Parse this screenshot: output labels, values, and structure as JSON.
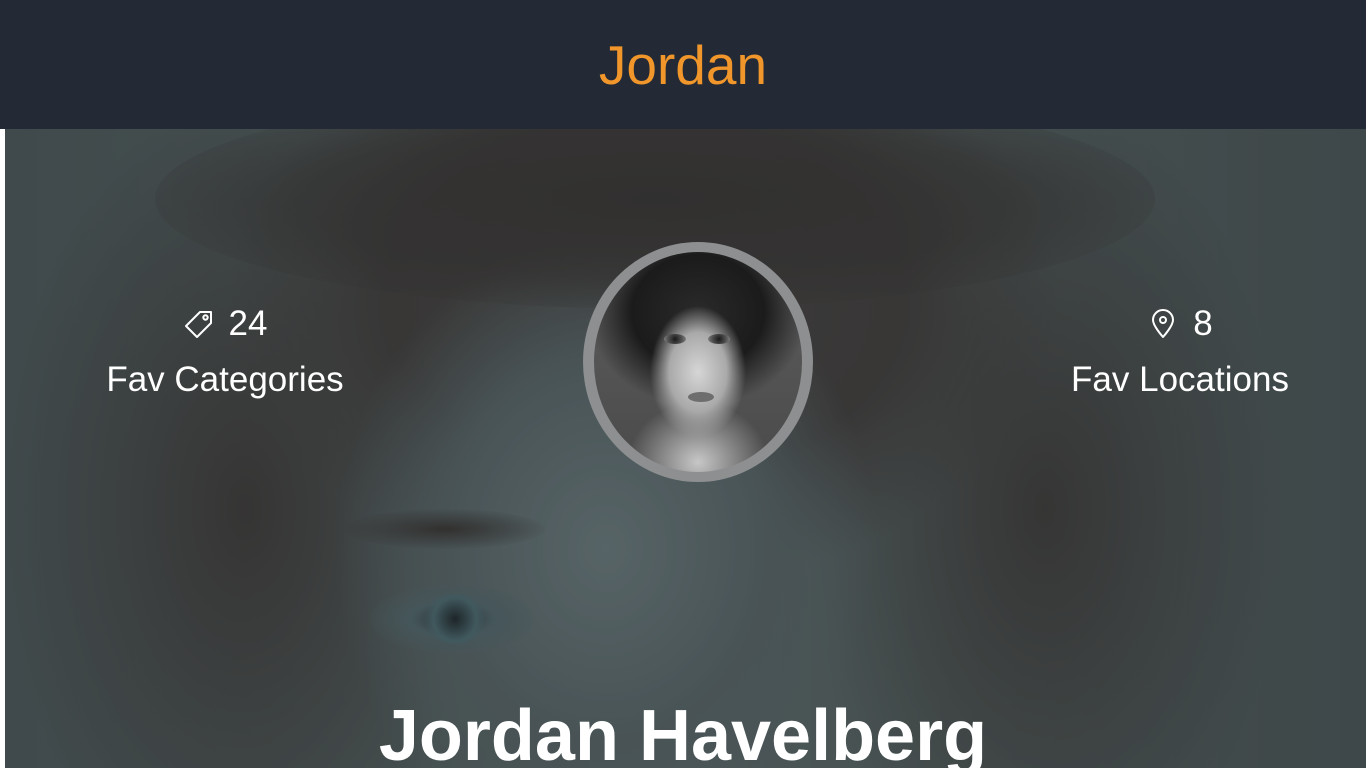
{
  "header": {
    "title": "Jordan"
  },
  "stats": {
    "categories": {
      "icon": "tag-icon",
      "count": "24",
      "label": "Fav Categories"
    },
    "locations": {
      "icon": "map-pin-icon",
      "count": "8",
      "label": "Fav Locations"
    }
  },
  "profile": {
    "name": "Jordan Havelberg",
    "avatar": "profile-avatar"
  },
  "colors": {
    "header_bg": "#232935",
    "title_accent": "#f0962a",
    "text": "#ffffff"
  }
}
